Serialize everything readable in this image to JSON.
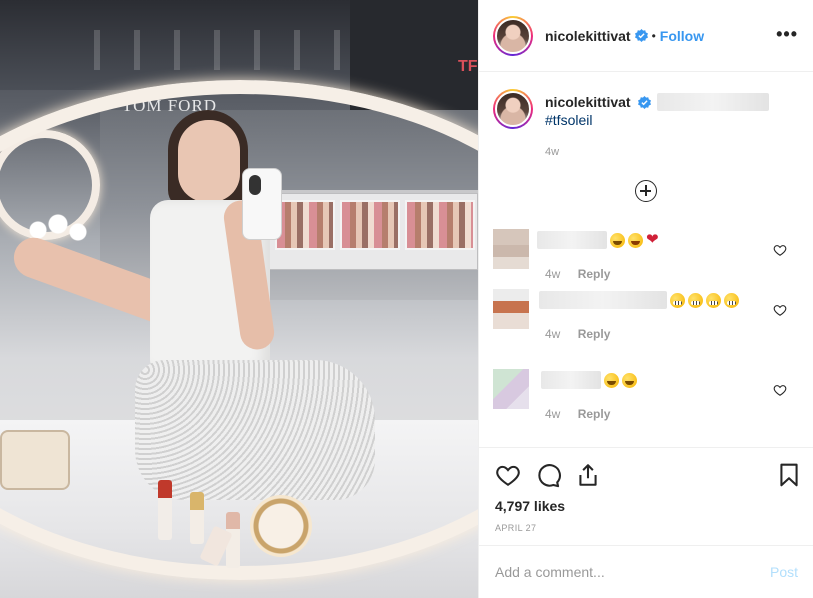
{
  "photo": {
    "brand_sign": "TOM FORD",
    "brand_sign_right": "TF"
  },
  "header": {
    "username": "nicolekittivat",
    "separator": "•",
    "follow_label": "Follow",
    "more_label": "•••"
  },
  "caption": {
    "username": "nicolekittivat",
    "hashtag": "#tfsoleil",
    "time": "4w"
  },
  "comments": [
    {
      "time": "4w",
      "reply_label": "Reply",
      "emojis": [
        "grin",
        "star-eyes",
        "heart"
      ]
    },
    {
      "time": "4w",
      "reply_label": "Reply",
      "emojis": [
        "teeth",
        "teeth",
        "teeth",
        "teeth"
      ]
    },
    {
      "time": "4w",
      "reply_label": "Reply",
      "emojis": [
        "grin",
        "grin"
      ]
    }
  ],
  "actions": {
    "likes": "4,797 likes",
    "date": "APRIL 27"
  },
  "add_comment": {
    "placeholder": "Add a comment...",
    "post_label": "Post"
  },
  "colors": {
    "accent": "#3897f0",
    "hashtag": "#003569",
    "muted": "#999999",
    "post_disabled": "#b2dffc"
  }
}
